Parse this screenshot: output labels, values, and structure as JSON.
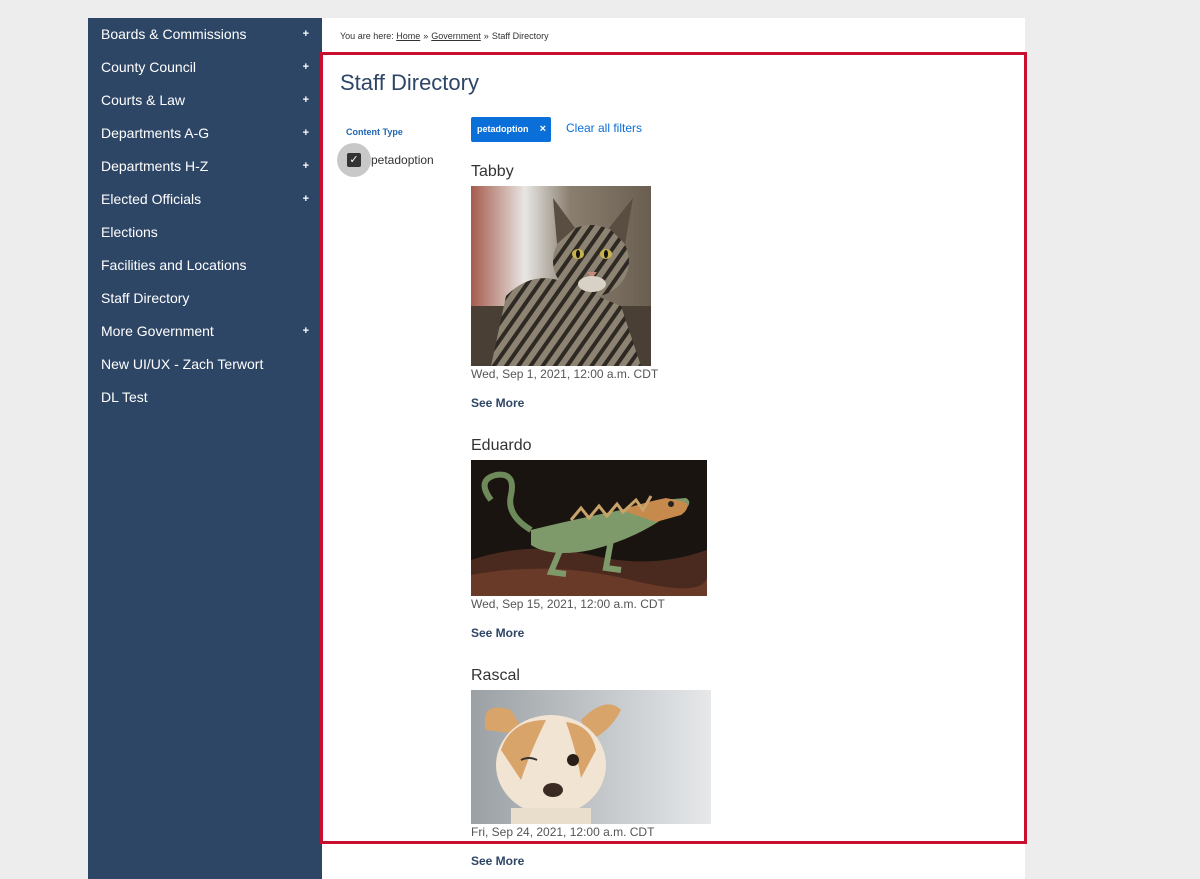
{
  "sidebar": {
    "items": [
      {
        "label": "Boards & Commissions",
        "expandable": true
      },
      {
        "label": "County Council",
        "expandable": true
      },
      {
        "label": "Courts & Law",
        "expandable": true
      },
      {
        "label": "Departments A-G",
        "expandable": true
      },
      {
        "label": "Departments H-Z",
        "expandable": true
      },
      {
        "label": "Elected Officials",
        "expandable": true
      },
      {
        "label": "Elections",
        "expandable": false
      },
      {
        "label": "Facilities and Locations",
        "expandable": false
      },
      {
        "label": "Staff Directory",
        "expandable": false
      },
      {
        "label": "More Government",
        "expandable": true
      },
      {
        "label": "New UI/UX - Zach Terwort",
        "expandable": false
      },
      {
        "label": "DL Test",
        "expandable": false
      }
    ],
    "plus_symbol": "+"
  },
  "breadcrumb": {
    "prefix": "You are here:",
    "home": "Home",
    "separator": "»",
    "government": "Government",
    "current": "Staff Directory"
  },
  "page": {
    "title": "Staff Directory"
  },
  "facets": {
    "label": "Content Type",
    "option": "petadoption",
    "checked": true
  },
  "active_filter": {
    "chip_label": "petadoption",
    "remove_symbol": "×",
    "clear_all": "Clear all filters"
  },
  "results": [
    {
      "name": "Tabby",
      "date": "Wed, Sep 1, 2021, 12:00 a.m. CDT",
      "link": "See More",
      "image": "tabby-cat-photo"
    },
    {
      "name": "Eduardo",
      "date": "Wed, Sep 15, 2021, 12:00 a.m. CDT",
      "link": "See More",
      "image": "lizard-photo"
    },
    {
      "name": "Rascal",
      "date": "Fri, Sep 24, 2021, 12:00 a.m. CDT",
      "link": "See More",
      "image": "chihuahua-photo"
    }
  ],
  "colors": {
    "sidebar_bg": "#2e4666",
    "highlight_border": "#c8102e",
    "chip_bg": "#0a6fd9",
    "link_blue": "#0a6fd9"
  }
}
